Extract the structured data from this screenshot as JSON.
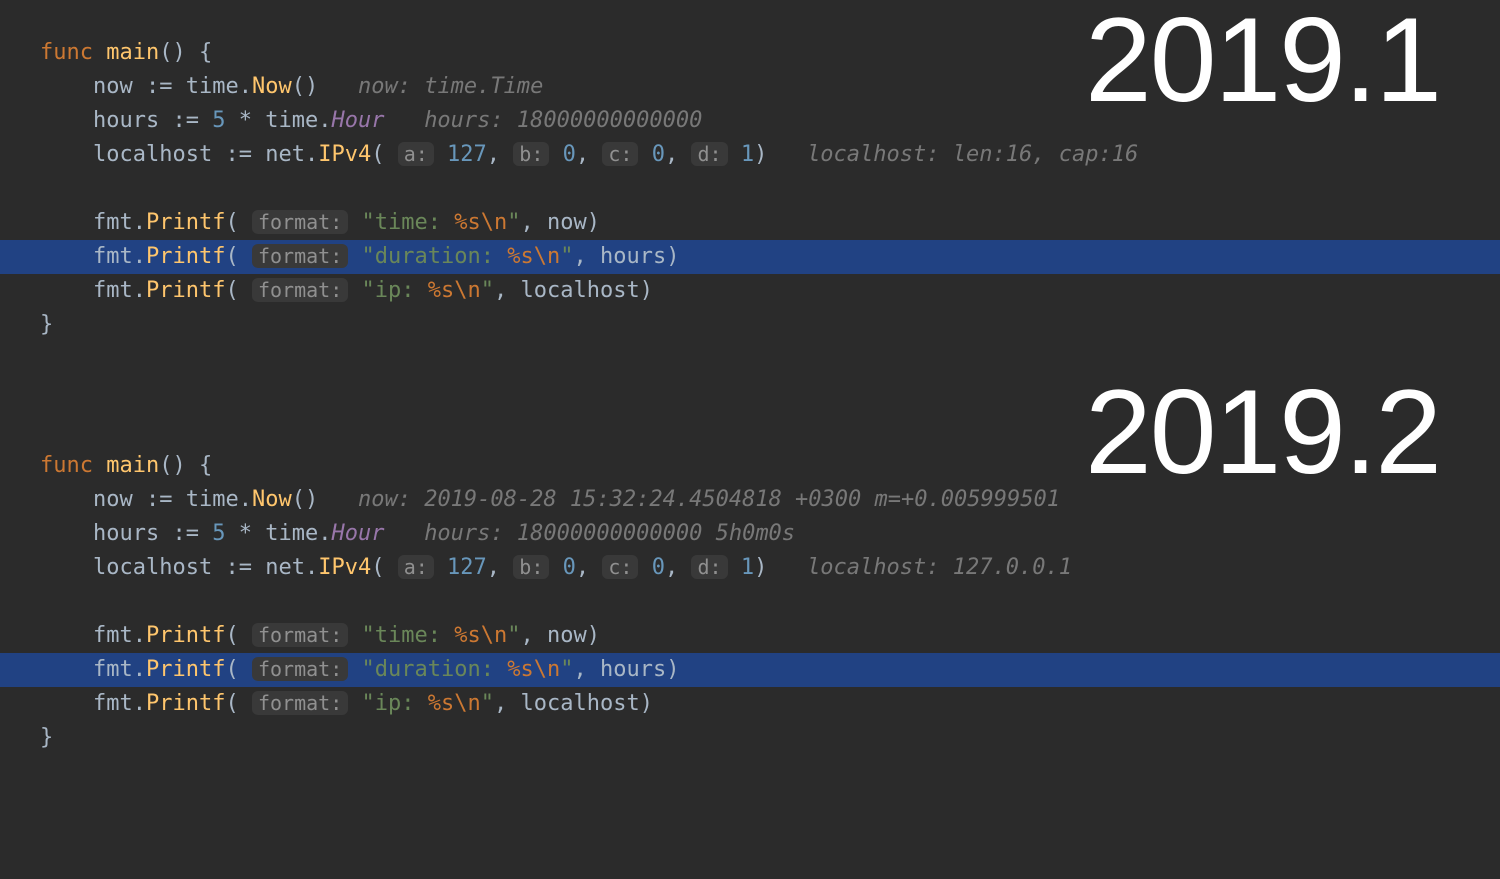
{
  "versions": {
    "v1": "2019.1",
    "v2": "2019.2"
  },
  "code": {
    "func_kw": "func",
    "main": "main",
    "now": "now",
    "hours": "hours",
    "localhost": "localhost",
    "time_pkg": "time",
    "Now": "Now",
    "Hour": "Hour",
    "net_pkg": "net",
    "IPv4": "IPv4",
    "fmt_pkg": "fmt",
    "Printf": "Printf",
    "five": "5",
    "ip_a": "127",
    "ip_b": "0",
    "ip_c": "0",
    "ip_d": "1",
    "a_label": "a:",
    "b_label": "b:",
    "c_label": "c:",
    "d_label": "d:",
    "format_label": "format:",
    "str_time": "\"time: ",
    "str_duration": "\"duration: ",
    "str_ip": "\"ip: ",
    "pct_s": "%s",
    "nl": "\\n",
    "endq": "\""
  },
  "hints": {
    "v1": {
      "now": "now: time.Time",
      "hours": "hours: 18000000000000",
      "localhost": "localhost: len:16, cap:16"
    },
    "v2": {
      "now": "now: 2019-08-28 15:32:24.4504818 +0300 m=+0.005999501",
      "hours": "hours: 18000000000000 5h0m0s",
      "localhost": "localhost: 127.0.0.1"
    }
  }
}
